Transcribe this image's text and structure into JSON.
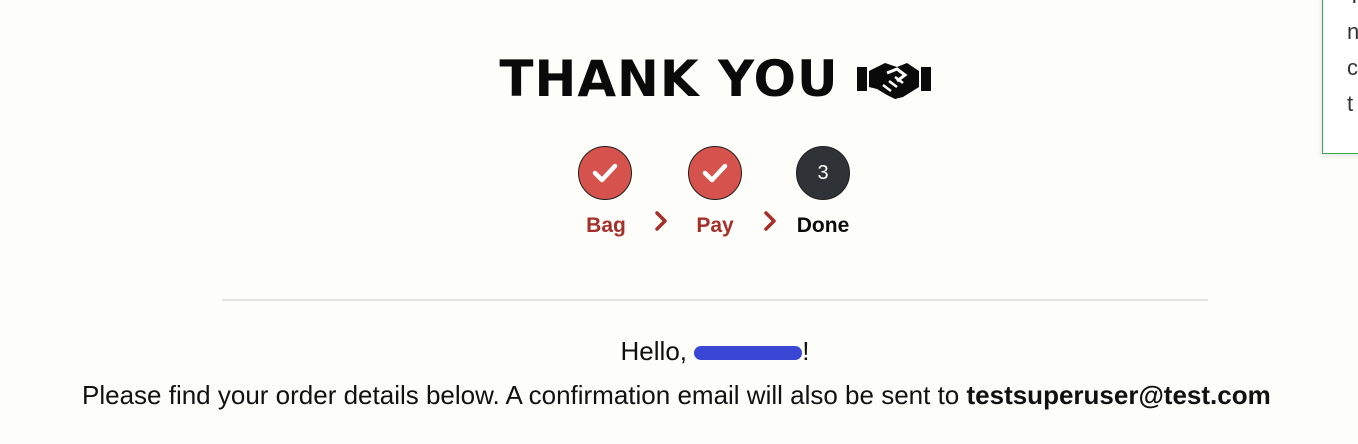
{
  "title": "THANK YOU",
  "steps": [
    {
      "label": "Bag",
      "state": "done",
      "icon": "check-icon"
    },
    {
      "label": "Pay",
      "state": "done",
      "icon": "check-icon"
    },
    {
      "label": "Done",
      "state": "current",
      "number": "3"
    }
  ],
  "greeting": {
    "prefix": "Hello, ",
    "suffix": "!"
  },
  "details": {
    "text": "Please find your order details below. A confirmation email will also be sent to ",
    "email": "testsuperuser@test.com"
  },
  "toast": {
    "lines": [
      "Y",
      "n",
      "c",
      "t"
    ]
  },
  "colors": {
    "done": "#d6524c",
    "done_text": "#a52f2a",
    "current": "#2f3338",
    "redaction": "#3a47d4",
    "toast_border": "#3aa35a"
  }
}
